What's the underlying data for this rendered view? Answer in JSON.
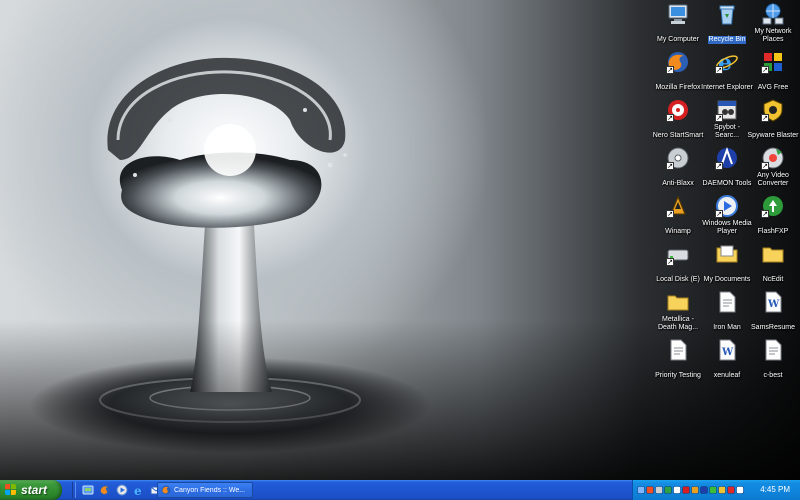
{
  "desktop": {
    "icons": [
      {
        "label": "My Computer",
        "icon": "my-computer-icon"
      },
      {
        "label": "Recycle Bin",
        "icon": "recycle-bin-icon",
        "selected": true
      },
      {
        "label": "My Network Places",
        "icon": "network-places-icon"
      },
      {
        "label": "Mozilla Firefox",
        "icon": "firefox-icon"
      },
      {
        "label": "Internet Explorer",
        "icon": "internet-explorer-icon"
      },
      {
        "label": "AVG Free",
        "icon": "avg-icon"
      },
      {
        "label": "Nero StartSmart",
        "icon": "nero-icon"
      },
      {
        "label": "Spybot - Searc...",
        "icon": "spybot-icon"
      },
      {
        "label": "Spyware Blaster",
        "icon": "spywareblaster-icon"
      },
      {
        "label": "Anti-Blaxx",
        "icon": "anti-blaxx-icon"
      },
      {
        "label": "DAEMON Tools",
        "icon": "daemon-tools-icon"
      },
      {
        "label": "Any Video Converter",
        "icon": "video-converter-icon"
      },
      {
        "label": "Winamp",
        "icon": "winamp-icon"
      },
      {
        "label": "Windows Media Player",
        "icon": "media-player-icon"
      },
      {
        "label": "FlashFXP",
        "icon": "flashfxp-icon"
      },
      {
        "label": "Local Disk (E)",
        "icon": "local-disk-icon"
      },
      {
        "label": "My Documents",
        "icon": "my-documents-icon"
      },
      {
        "label": "NcEdit",
        "icon": "folder-icon"
      },
      {
        "label": "Metallica - Death Mag...",
        "icon": "folder-icon"
      },
      {
        "label": "Iron Man",
        "icon": "document-icon"
      },
      {
        "label": "SamsResume",
        "icon": "word-document-icon"
      },
      {
        "label": "Priority Testing",
        "icon": "document-icon"
      },
      {
        "label": "xenuleaf",
        "icon": "word-document-icon"
      },
      {
        "label": "c-best",
        "icon": "document-icon"
      }
    ]
  },
  "taskbar": {
    "start_label": "start",
    "quick_launch": [
      "show-desktop-icon",
      "firefox-icon",
      "media-player-icon",
      "internet-explorer-icon",
      "outlook-icon"
    ],
    "task_button": {
      "label": "Canyon Fiends :: We...",
      "icon": "firefox-icon"
    },
    "tray_icons": [
      "network-icon",
      "flag-icon",
      "security-icon",
      "shield-icon",
      "volume-icon",
      "antivirus-icon",
      "winamp-tray-icon",
      "daemon-tray-icon",
      "messenger-icon",
      "update-icon",
      "power-icon",
      "misc-icon"
    ],
    "clock": "4:45 PM"
  },
  "colors": {
    "taskbar_blue": "#245edb",
    "start_green": "#3c9a3c",
    "tray_blue": "#0f86dc",
    "selection_blue": "#316ac5"
  }
}
